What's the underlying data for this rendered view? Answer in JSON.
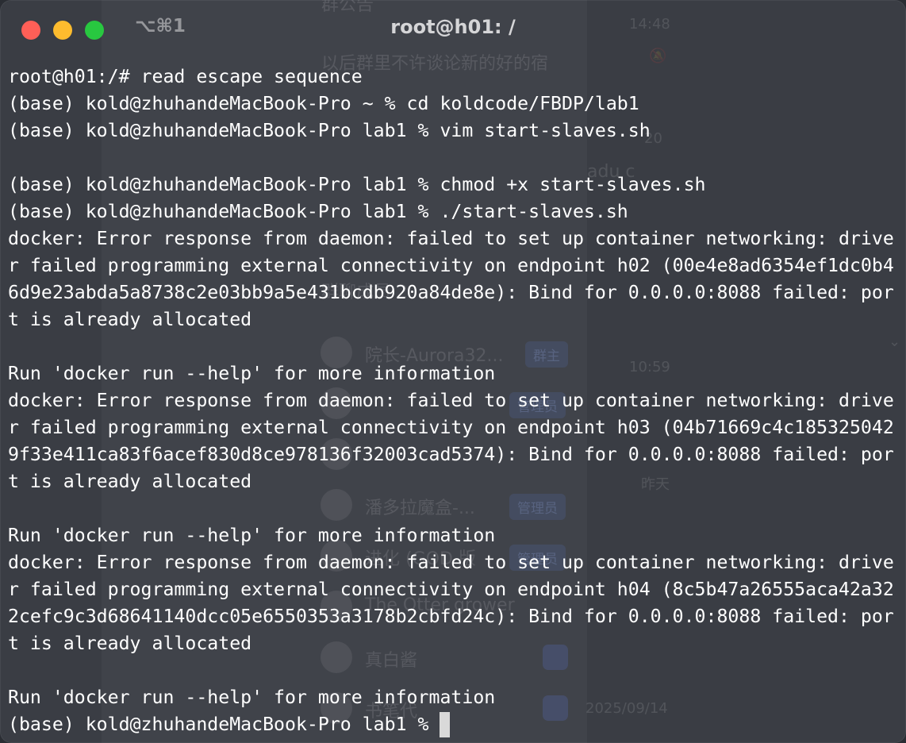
{
  "window": {
    "title": "root@h01: /",
    "shortcut": "⌥⌘1",
    "traffic_lights": {
      "close_color": "#ff5f57",
      "minimize_color": "#febc2e",
      "zoom_color": "#28c840"
    }
  },
  "terminal": {
    "lines": [
      "root@h01:/# read escape sequence",
      "(base) kold@zhuhandeMacBook-Pro ~ % cd koldcode/FBDP/lab1",
      "(base) kold@zhuhandeMacBook-Pro lab1 % vim start-slaves.sh",
      "",
      "(base) kold@zhuhandeMacBook-Pro lab1 % chmod +x start-slaves.sh",
      "(base) kold@zhuhandeMacBook-Pro lab1 % ./start-slaves.sh",
      "docker: Error response from daemon: failed to set up container networking: drive",
      "r failed programming external connectivity on endpoint h02 (00e4e8ad6354ef1dc0b4",
      "6d9e23abda5a8738c2e03bb9a5e431bcdb920a84de8e): Bind for 0.0.0.0:8088 failed: por",
      "t is already allocated",
      "",
      "Run 'docker run --help' for more information",
      "docker: Error response from daemon: failed to set up container networking: drive",
      "r failed programming external connectivity on endpoint h03 (04b71669c4c185325042",
      "9f33e411ca83f6acef830d8ce978136f32003cad5374): Bind for 0.0.0.0:8088 failed: por",
      "t is already allocated",
      "",
      "Run 'docker run --help' for more information",
      "docker: Error response from daemon: failed to set up container networking: drive",
      "r failed programming external connectivity on endpoint h04 (8c5b47a26555aca42a32",
      "2cefc9c3d68641140dcc05e6550353a3178b2cbfd24c): Bind for 0.0.0.0:8088 failed: por",
      "t is already allocated",
      "",
      "Run 'docker run --help' for more information"
    ],
    "prompt": "(base) kold@zhuhandeMacBook-Pro lab1 % "
  },
  "background_app": {
    "group_notice_title": "群公告",
    "group_notice_text": "以后群里不许谈论新的好的宿",
    "time_1": "14:48",
    "time_2": "20",
    "name_partial": "adu c",
    "members_label": "群聊成员 2",
    "member_1": "院长-Aurora32...",
    "member_1_badge": "群主",
    "time_3": "10:59",
    "member_2_badge": "管理员",
    "time_4": "昨天",
    "member_3": "潘多拉魔盒-...",
    "member_3_badge": "管理员",
    "member_4": "进化 (GOD 版",
    "member_4_badge": "管理员",
    "member_5": "The Otter grower",
    "member_6": "真白酱",
    "member_7": "书笔代",
    "time_5": "2025/09/14"
  },
  "colors": {
    "terminal_bg": "#3a3d44",
    "terminal_fg": "#ffffff",
    "cursor": "#d9d9d9"
  }
}
